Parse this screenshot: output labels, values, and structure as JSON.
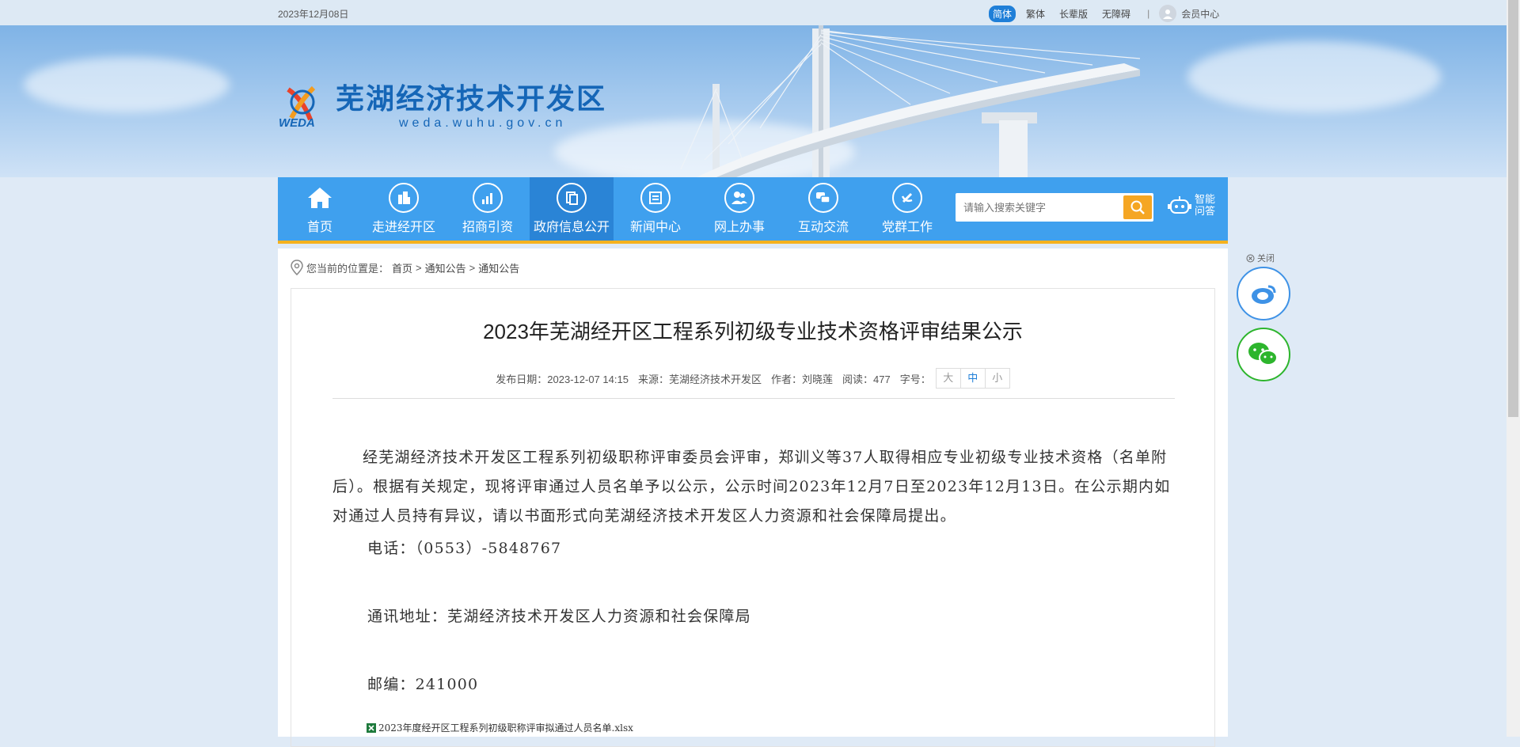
{
  "topbar": {
    "date": "2023年12月08日",
    "lang_simplified": "简体",
    "lang_traditional": "繁体",
    "elder_mode": "长辈版",
    "accessibility": "无障碍",
    "separator": "|",
    "member_center": "会员中心"
  },
  "site": {
    "logo_title": "芜湖经济技术开发区",
    "logo_domain": "weda.wuhu.gov.cn",
    "logo_mark": "WEDA"
  },
  "nav": {
    "items": [
      {
        "label": "首页",
        "icon": "home-icon"
      },
      {
        "label": "走进经开区",
        "icon": "buildings-icon"
      },
      {
        "label": "招商引资",
        "icon": "chart-icon"
      },
      {
        "label": "政府信息公开",
        "icon": "document-icon"
      },
      {
        "label": "新闻中心",
        "icon": "news-icon"
      },
      {
        "label": "网上办事",
        "icon": "people-icon"
      },
      {
        "label": "互动交流",
        "icon": "chat-icon"
      },
      {
        "label": "党群工作",
        "icon": "party-emblem-icon"
      }
    ],
    "active_index": 3,
    "search_placeholder": "请输入搜索关键字",
    "ai_line1": "智能",
    "ai_line2": "问答"
  },
  "breadcrumb": {
    "prefix": "您当前的位置是：",
    "items": [
      "首页",
      "通知公告",
      "通知公告"
    ],
    "separator": ">"
  },
  "article": {
    "title": "2023年芜湖经开区工程系列初级专业技术资格评审结果公示",
    "publish_label": "发布日期：",
    "publish_date": "2023-12-07 14:15",
    "source_label": "来源：",
    "source": "芜湖经济技术开发区",
    "author_label": "作者：",
    "author": "刘晓莲",
    "views_label": "阅读：",
    "views": "477",
    "fontsize_label": "字号：",
    "fontsize_options": [
      "大",
      "中",
      "小"
    ],
    "paragraph": "经芜湖经济技术开发区工程系列初级职称评审委员会评审，郑训义等37人取得相应专业初级专业技术资格（名单附后）。根据有关规定，现将评审通过人员名单予以公示，公示时间2023年12月7日至2023年12月13日。在公示期内如对通过人员持有异议，请以书面形式向芜湖经济技术开发区人力资源和社会保障局提出。",
    "phone": "电话：（0553）-5848767",
    "address": "通讯地址：芜湖经济技术开发区人力资源和社会保障局",
    "postcode": "邮编：241000",
    "attachment": "2023年度经开区工程系列初级职称评审拟通过人员名单.xlsx"
  },
  "float": {
    "close_label": "关闭",
    "weibo_icon": "weibo-icon",
    "wechat_icon": "wechat-icon"
  },
  "colors": {
    "nav_bg": "#3fa0ee",
    "nav_active": "#2a84d6",
    "nav_underline": "#f5b21f",
    "search_button": "#f5a623",
    "brand_blue": "#1566b7"
  }
}
